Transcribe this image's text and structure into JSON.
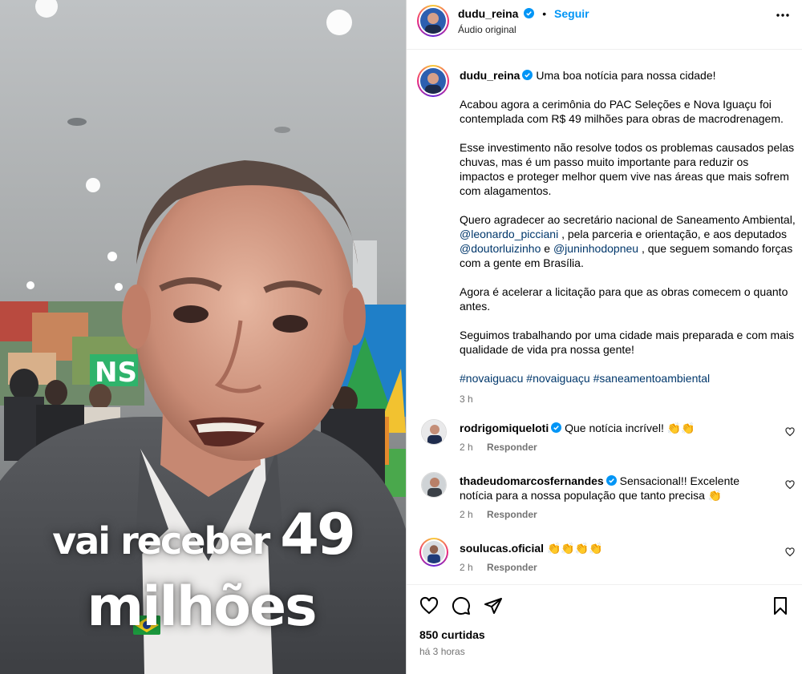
{
  "header": {
    "username": "dudu_reina",
    "separator": "•",
    "follow_label": "Seguir",
    "audio_label": "Áudio original"
  },
  "media": {
    "caption_line1": "vai receber",
    "caption_number": "49",
    "caption_line2": "milhões",
    "banner_text": "NS"
  },
  "post": {
    "username": "dudu_reina",
    "headline": "Uma boa notícia para nossa cidade!",
    "p1": "Acabou agora a cerimônia do PAC Seleções e Nova Iguaçu foi contemplada com R$ 49 milhões para obras de macrodrenagem.",
    "p2": "Esse investimento não resolve todos os problemas causados pelas chuvas, mas é um passo muito importante para reduzir os impactos e proteger melhor quem vive nas áreas que mais sofrem com alagamentos.",
    "p3a": "Quero agradecer ao secretário nacional de Saneamento Ambiental, ",
    "mention1": "@leonardo_picciani",
    "p3b": " , pela parceria e orientação, e aos deputados ",
    "mention2": "@doutorluizinho",
    "p3c": " e ",
    "mention3": "@juninhodopneu",
    "p3d": " , que seguem somando forças com a gente em Brasília.",
    "p4": "Agora é acelerar a licitação para que as obras comecem o quanto antes.",
    "p5": "Seguimos trabalhando por uma cidade mais preparada e com mais qualidade de vida pra nossa gente!",
    "hashtags": [
      "#novaiguacu",
      "#novaiguaçu",
      "#saneamentoambiental"
    ],
    "time": "3 h"
  },
  "comments": [
    {
      "username": "rodrigomiqueloti",
      "text": "Que notícia incrível! 👏👏",
      "time": "2 h",
      "reply": "Responder"
    },
    {
      "username": "thadeudomarcosfernandes",
      "text": "Sensacional!! Excelente notícia para a nossa população que tanto precisa 👏",
      "time": "2 h",
      "reply": "Responder"
    },
    {
      "username": "soulucas.oficial",
      "text": "👏👏👏👏",
      "time": "2 h",
      "reply": "Responder"
    }
  ],
  "footer": {
    "likes": "850 curtidas",
    "ago": "há 3 horas"
  },
  "colors": {
    "accent": "#0095f6",
    "mention": "#00376b",
    "muted": "#737373",
    "verified": "#0095f6"
  }
}
